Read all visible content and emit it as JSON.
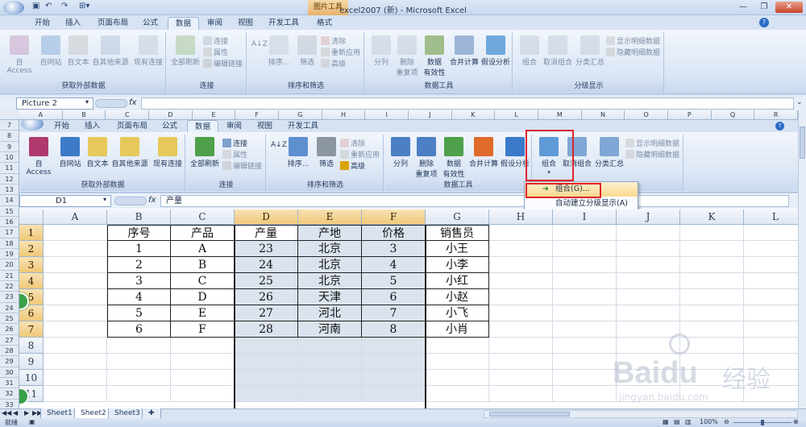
{
  "window": {
    "title": "excel2007 (新) - Microsoft Excel",
    "context_tab": "图片工具",
    "minimize": "—",
    "restore": "❐",
    "close": "✕"
  },
  "outer": {
    "tabs": [
      "开始",
      "插入",
      "页面布局",
      "公式",
      "数据",
      "审阅",
      "视图",
      "开发工具",
      "格式"
    ],
    "active_tab": "数据",
    "groups": [
      {
        "label": "获取外部数据",
        "buttons": [
          "自 Access",
          "自网站",
          "自文本",
          "自其他来源",
          "现有连接"
        ]
      },
      {
        "label": "连接",
        "buttons": [
          "全部刷新"
        ],
        "small": [
          "连接",
          "属性",
          "编辑链接"
        ]
      },
      {
        "label": "排序和筛选",
        "buttons": [
          "排序...",
          "筛选"
        ],
        "small": [
          "清除",
          "重新应用",
          "高级"
        ]
      },
      {
        "label": "数据工具",
        "buttons": [
          "分列",
          "删除\n重复项",
          "数据\n有效性",
          "合并计算",
          "假设分析"
        ]
      },
      {
        "label": "分级显示",
        "buttons": [
          "组合",
          "取消组合",
          "分类汇总"
        ],
        "small": [
          "显示明细数据",
          "隐藏明细数据"
        ]
      }
    ],
    "name_box": "Picture 2",
    "fx": "fx"
  },
  "outer_cols": [
    "A",
    "B",
    "C",
    "D",
    "E",
    "F",
    "G",
    "H",
    "I",
    "J",
    "K",
    "L",
    "M",
    "N",
    "O",
    "P",
    "Q",
    "R"
  ],
  "inner": {
    "tabs": [
      "开始",
      "插入",
      "页面布局",
      "公式",
      "数据",
      "审阅",
      "视图",
      "开发工具"
    ],
    "active_tab": "数据",
    "groups": [
      {
        "label": "获取外部数据",
        "buttons": [
          "自 Access",
          "自网站",
          "自文本",
          "自其他来源",
          "现有连接"
        ]
      },
      {
        "label": "连接",
        "buttons": [
          "全部刷新"
        ],
        "small": [
          "连接",
          "属性",
          "编辑链接"
        ]
      },
      {
        "label": "排序和筛选",
        "buttons": [
          "排序...",
          "筛选"
        ],
        "small": [
          "清除",
          "重新应用",
          "高级"
        ]
      },
      {
        "label": "数据工具",
        "buttons": [
          "分列",
          "删除\n重复项",
          "数据\n有效性",
          "合并计算",
          "假设分析"
        ]
      },
      {
        "label": "",
        "buttons": [
          "组合",
          "取消组合",
          "分类汇总"
        ],
        "small": [
          "显示明细数据",
          "隐藏明细数据"
        ]
      }
    ],
    "name_box": "D1",
    "fx": "fx",
    "formula_value": "产量",
    "menu": [
      "组合(G)...",
      "自动建立分级显示(A)"
    ]
  },
  "outer_row_numbers": [
    "7",
    "8",
    "9",
    "10",
    "11",
    "12",
    "13",
    "14",
    "15",
    "16",
    "17",
    "18",
    "19",
    "20",
    "21",
    "22",
    "23",
    "24",
    "25",
    "26",
    "27",
    "28",
    "29",
    "30",
    "31",
    "32",
    "33"
  ],
  "sheet": {
    "cols": [
      "A",
      "B",
      "C",
      "D",
      "E",
      "F",
      "G",
      "H",
      "I",
      "J",
      "K",
      "L"
    ],
    "rows": [
      "1",
      "2",
      "3",
      "4",
      "5",
      "6",
      "7",
      "8",
      "9",
      "10",
      "11"
    ],
    "header": [
      "序号",
      "产品",
      "产量",
      "产地",
      "价格",
      "销售员"
    ],
    "data": [
      [
        "1",
        "A",
        "23",
        "北京",
        "3",
        "小王"
      ],
      [
        "2",
        "B",
        "24",
        "北京",
        "4",
        "小李"
      ],
      [
        "3",
        "C",
        "25",
        "北京",
        "5",
        "小红"
      ],
      [
        "4",
        "D",
        "26",
        "天津",
        "6",
        "小赵"
      ],
      [
        "5",
        "E",
        "27",
        "河北",
        "7",
        "小飞"
      ],
      [
        "6",
        "F",
        "28",
        "河南",
        "8",
        "小肖"
      ]
    ]
  },
  "sheets": [
    "Sheet1",
    "Sheet2",
    "Sheet3"
  ],
  "active_sheet": "Sheet2",
  "status": {
    "ready": "就绪",
    "zoom": "100%"
  },
  "watermark": {
    "brand": "Baidu",
    "cn": "经验",
    "url": "jingyan.baidu.com"
  },
  "colors": {
    "accent": "#2b579a",
    "selection_header": "#f0c879",
    "highlight_red": "#e0242c"
  }
}
